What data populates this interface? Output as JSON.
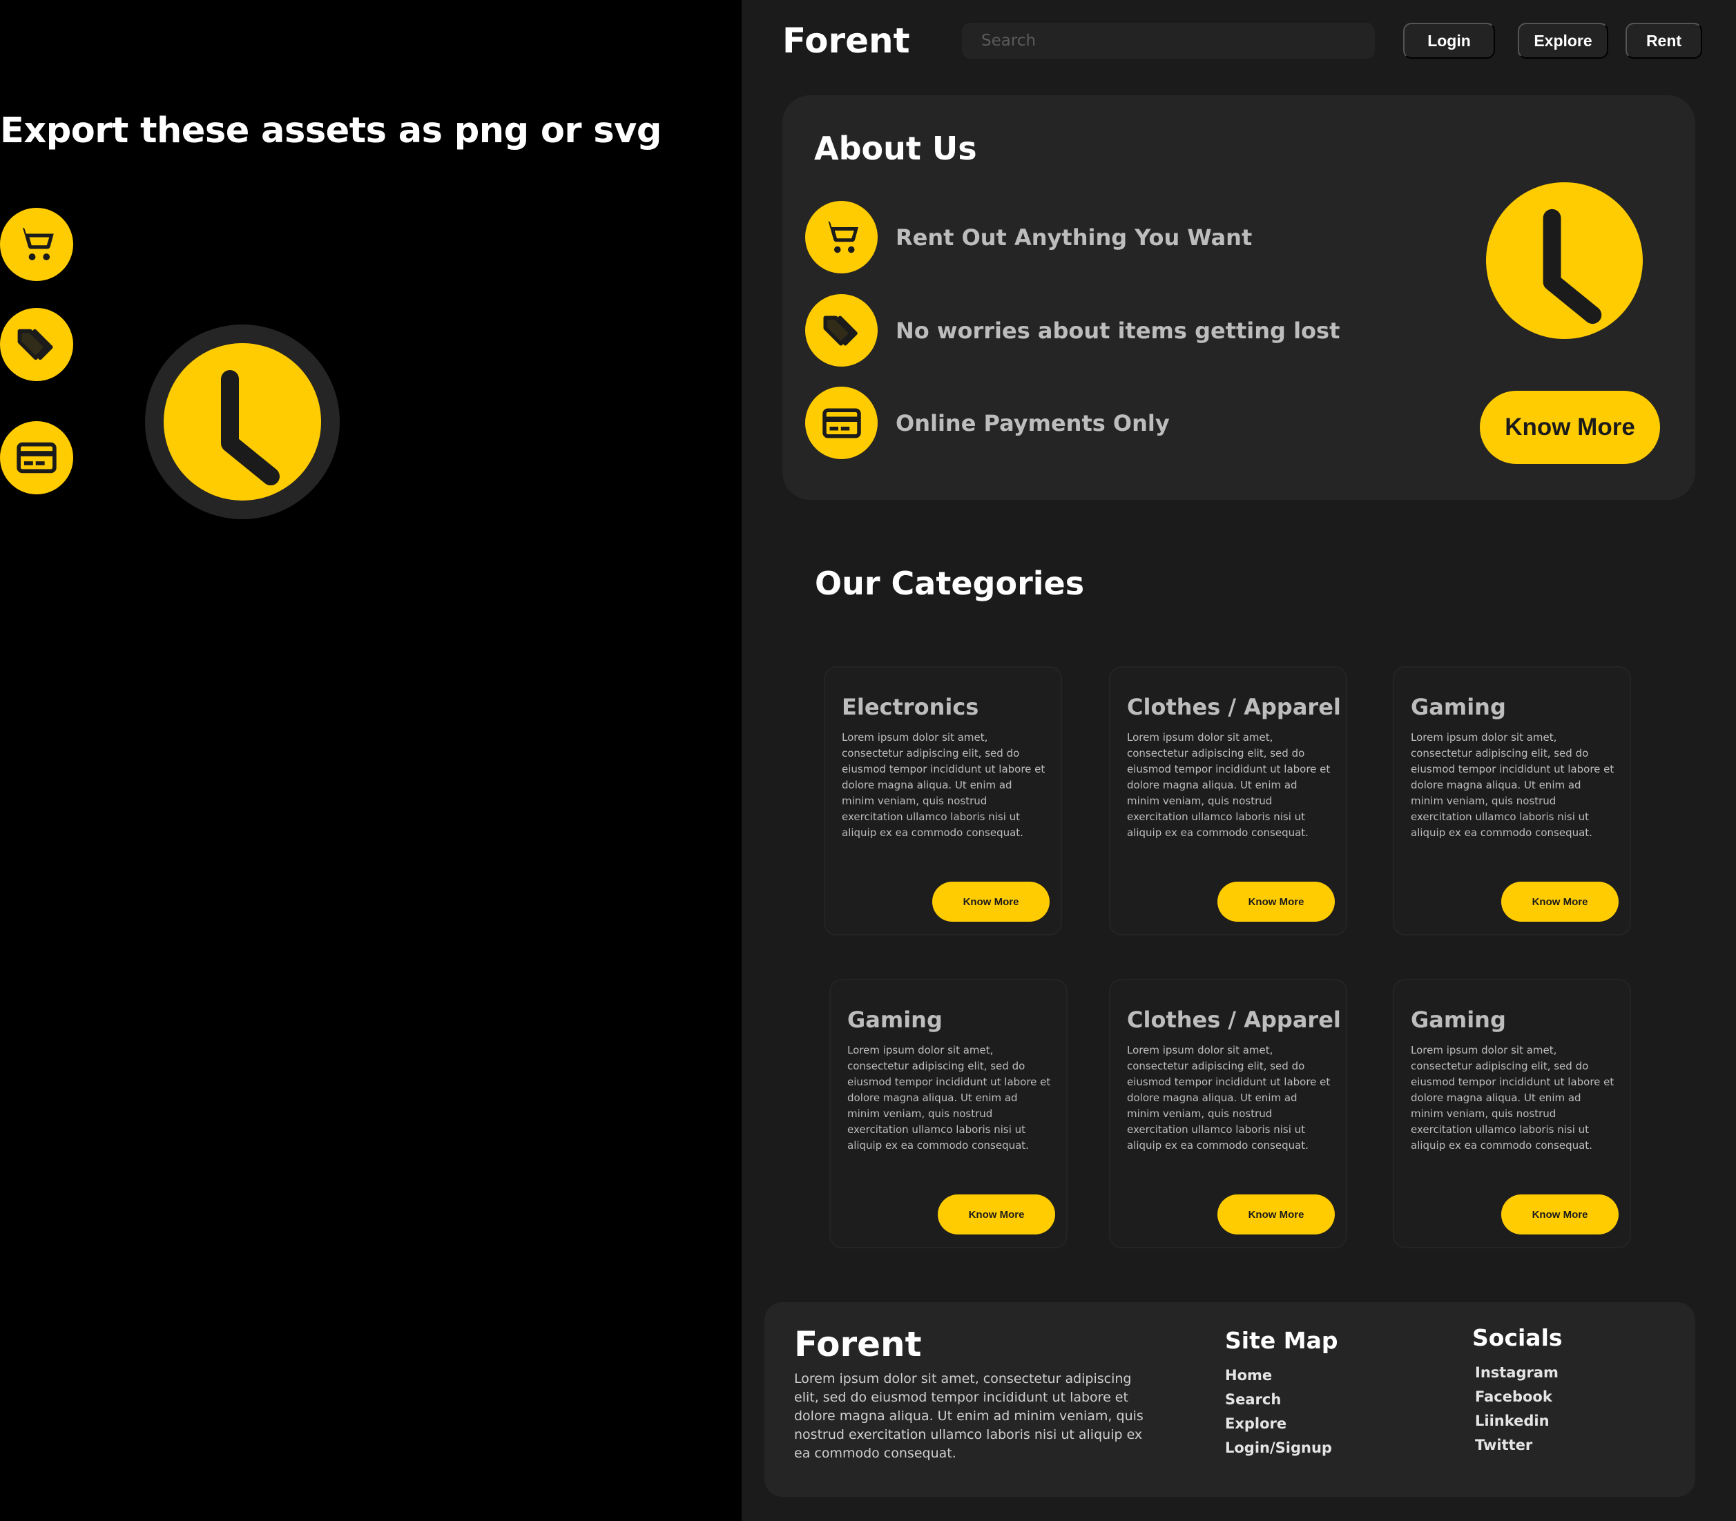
{
  "assets": {
    "title": "Export these assets as png or svg",
    "icons": [
      "cart-icon",
      "tag-icon",
      "credit-card-icon",
      "clock-icon"
    ]
  },
  "header": {
    "brand": "Forent",
    "search_placeholder": "Search",
    "nav": [
      "Login",
      "Explore",
      "Rent"
    ]
  },
  "about": {
    "title": "About Us",
    "items": [
      {
        "icon": "cart-icon",
        "label": "Rent Out Anything You Want"
      },
      {
        "icon": "tag-icon",
        "label": "No worries about items getting lost"
      },
      {
        "icon": "credit-card-icon",
        "label": "Online Payments Only"
      }
    ],
    "button": "Know More"
  },
  "categories": {
    "title": "Our Categories",
    "items": [
      {
        "title": "Electronics",
        "body": "Lorem ipsum dolor sit amet, consectetur adipiscing elit, sed do eiusmod tempor incididunt ut labore et dolore magna aliqua. Ut enim ad minim veniam, quis nostrud exercitation ullamco laboris nisi ut aliquip ex ea commodo consequat.",
        "button": "Know More"
      },
      {
        "title": "Clothes / Apparel",
        "body": "Lorem ipsum dolor sit amet, consectetur adipiscing elit, sed do eiusmod tempor incididunt ut labore et dolore magna aliqua. Ut enim ad minim veniam, quis nostrud exercitation ullamco laboris nisi ut aliquip ex ea commodo consequat.",
        "button": "Know More"
      },
      {
        "title": "Gaming",
        "body": "Lorem ipsum dolor sit amet, consectetur adipiscing elit, sed do eiusmod tempor incididunt ut labore et dolore magna aliqua. Ut enim ad minim veniam, quis nostrud exercitation ullamco laboris nisi ut aliquip ex ea commodo consequat.",
        "button": "Know More"
      },
      {
        "title": "Gaming",
        "body": "Lorem ipsum dolor sit amet, consectetur adipiscing elit, sed do eiusmod tempor incididunt ut labore et dolore magna aliqua. Ut enim ad minim veniam, quis nostrud exercitation ullamco laboris nisi ut aliquip ex ea commodo consequat.",
        "button": "Know More"
      },
      {
        "title": "Clothes / Apparel",
        "body": "Lorem ipsum dolor sit amet, consectetur adipiscing elit, sed do eiusmod tempor incididunt ut labore et dolore magna aliqua. Ut enim ad minim veniam, quis nostrud exercitation ullamco laboris nisi ut aliquip ex ea commodo consequat.",
        "button": "Know More"
      },
      {
        "title": "Gaming",
        "body": "Lorem ipsum dolor sit amet, consectetur adipiscing elit, sed do eiusmod tempor incididunt ut labore et dolore magna aliqua. Ut enim ad minim veniam, quis nostrud exercitation ullamco laboris nisi ut aliquip ex ea commodo consequat.",
        "button": "Know More"
      }
    ]
  },
  "footer": {
    "brand": "Forent",
    "description": "Lorem ipsum dolor sit amet, consectetur adipiscing elit, sed do eiusmod tempor incididunt ut labore et dolore magna aliqua. Ut enim ad minim veniam, quis nostrud exercitation ullamco laboris nisi ut aliquip ex ea commodo consequat.",
    "sitemap": {
      "title": "Site Map",
      "links": [
        "Home",
        "Search",
        "Explore",
        "Login/Signup"
      ]
    },
    "socials": {
      "title": "Socials",
      "links": [
        "Instagram",
        "Facebook",
        "Liinkedin",
        "Twitter"
      ]
    }
  },
  "colors": {
    "accent": "#FFCC02",
    "background": "#1B1B1B",
    "card": "#252525",
    "text_muted": "#BDBDBD"
  }
}
